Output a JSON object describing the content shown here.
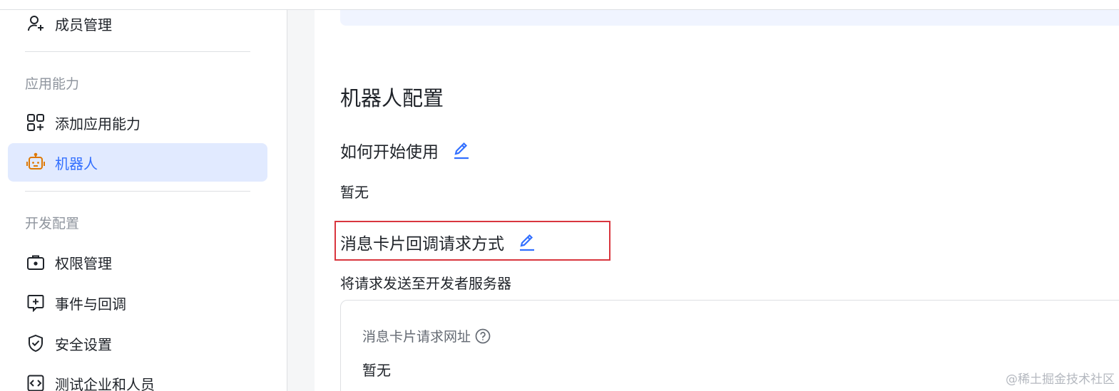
{
  "sidebar": {
    "items": [
      {
        "label": "成员管理",
        "icon": "person-add-icon"
      },
      {
        "label": "添加应用能力",
        "icon": "apps-add-icon"
      },
      {
        "label": "机器人",
        "icon": "robot-icon",
        "active": true
      },
      {
        "label": "权限管理",
        "icon": "briefcase-lock-icon"
      },
      {
        "label": "事件与回调",
        "icon": "square-plus-icon"
      },
      {
        "label": "安全设置",
        "icon": "shield-check-icon"
      },
      {
        "label": "测试企业和人员",
        "icon": "code-box-icon"
      }
    ],
    "groups": {
      "app_capability": "应用能力",
      "dev_config": "开发配置"
    }
  },
  "main": {
    "section_title": "机器人配置",
    "how_to_start": {
      "title": "如何开始使用",
      "value": "暂无"
    },
    "card_callback": {
      "title": "消息卡片回调请求方式",
      "value": "将请求发送至开发者服务器"
    },
    "card": {
      "label": "消息卡片请求网址",
      "value": "暂无"
    }
  },
  "watermark": "@稀土掘金技术社区",
  "colors": {
    "accent": "#3370ff",
    "active_bg": "#e1eaff",
    "robot_icon": "#de7802",
    "highlight_border": "#d9363e"
  }
}
